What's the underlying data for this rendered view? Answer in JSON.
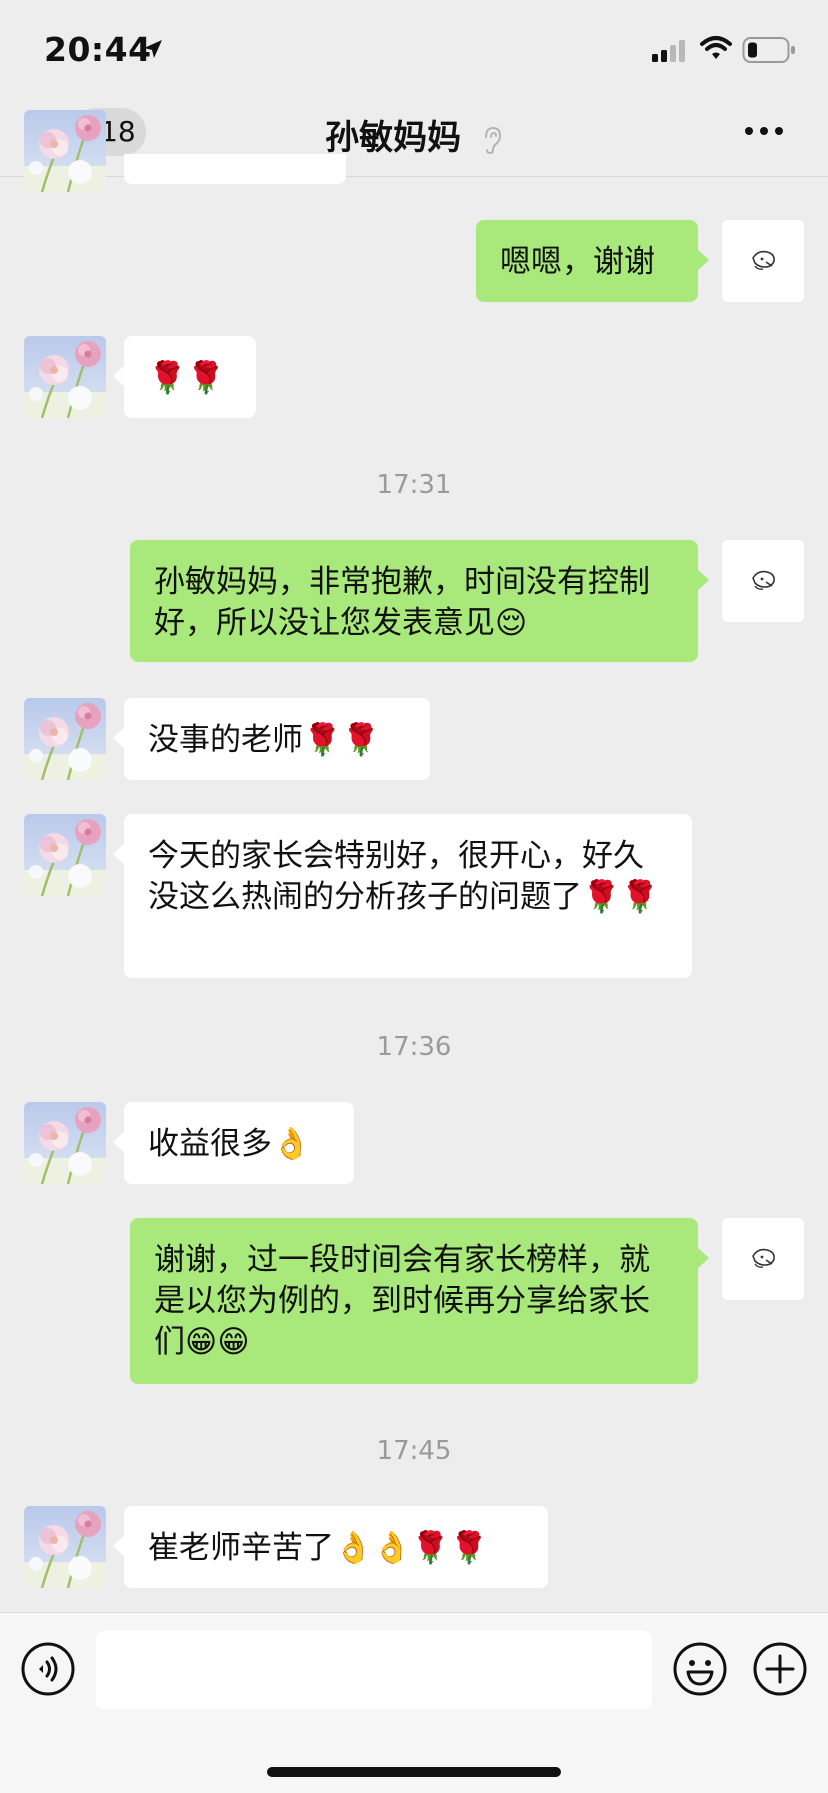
{
  "status_bar": {
    "time": "20:44"
  },
  "header": {
    "back_count": "118",
    "title": "孙敏妈妈"
  },
  "messages": [
    {
      "type": "out",
      "text": "嗯嗯，谢谢"
    },
    {
      "type": "in",
      "text": "🌹🌹"
    },
    {
      "type": "time",
      "text": "17:31"
    },
    {
      "type": "out",
      "text": "孙敏妈妈，非常抱歉，时间没有控制好，所以没让您发表意见😌"
    },
    {
      "type": "in",
      "text": "没事的老师🌹🌹"
    },
    {
      "type": "in",
      "text": "今天的家长会特别好，很开心，好久没这么热闹的分析孩子的问题了🌹🌹"
    },
    {
      "type": "time",
      "text": "17:36"
    },
    {
      "type": "in",
      "text": "收益很多👌"
    },
    {
      "type": "out",
      "text": "谢谢，过一段时间会有家长榜样，就是以您为例的，到时候再分享给家长们😁😁"
    },
    {
      "type": "time",
      "text": "17:45"
    },
    {
      "type": "in",
      "text": "崔老师辛苦了👌👌🌹🌹"
    }
  ],
  "input": {
    "value": ""
  },
  "icons": {
    "status": [
      "location-arrow-icon",
      "cellular-signal-icon",
      "wifi-icon",
      "battery-icon"
    ],
    "nav": [
      "back-chevron-icon",
      "ear-icon",
      "more-options-icon"
    ],
    "input_bar": [
      "voice-icon",
      "emoji-icon",
      "plus-icon"
    ]
  },
  "colors": {
    "background": "#ededed",
    "outgoing_bubble": "#a9e87a",
    "incoming_bubble": "#ffffff",
    "timestamp": "#9a9a9a"
  }
}
